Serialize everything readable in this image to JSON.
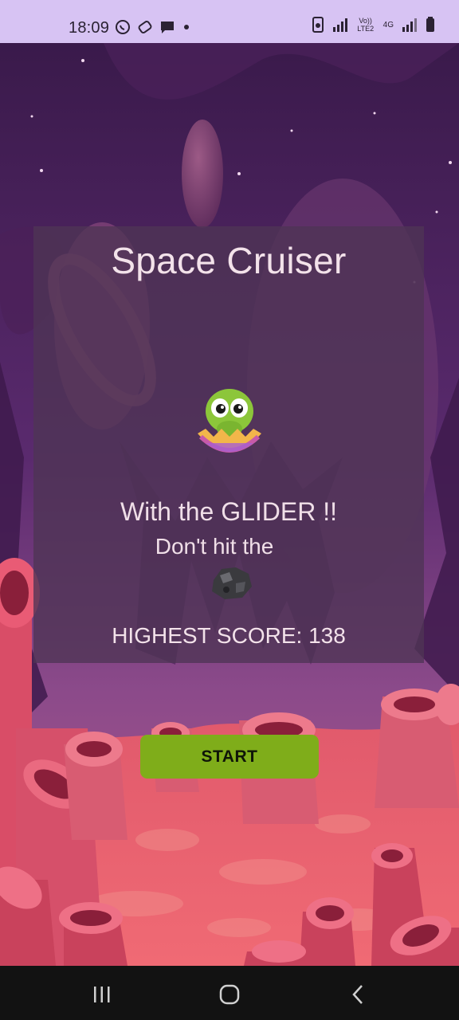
{
  "status_bar": {
    "time": "18:09",
    "left_icons": [
      "whatsapp-icon",
      "gamepad-icon",
      "message-icon",
      "dot-icon"
    ],
    "network_label_top": "Vo)) LTE2",
    "network_label_4g": "4G",
    "right_icons": [
      "notification-icon",
      "signal-icon",
      "signal-icon",
      "battery-icon"
    ]
  },
  "card": {
    "title": "Space Cruiser",
    "line1": "With the GLIDER !!",
    "line2": "Don't hit the",
    "score_text": "HIGHEST SCORE: 138"
  },
  "start_button": {
    "label": "START",
    "color": "#7fad1a"
  },
  "colors": {
    "status_bar_bg": "#d7c3f3",
    "sky_top": "#3b1a4e",
    "ground": "#e46a78",
    "nav_bar": "#121212"
  },
  "nav": [
    "recent-apps-icon",
    "home-icon",
    "back-icon"
  ]
}
